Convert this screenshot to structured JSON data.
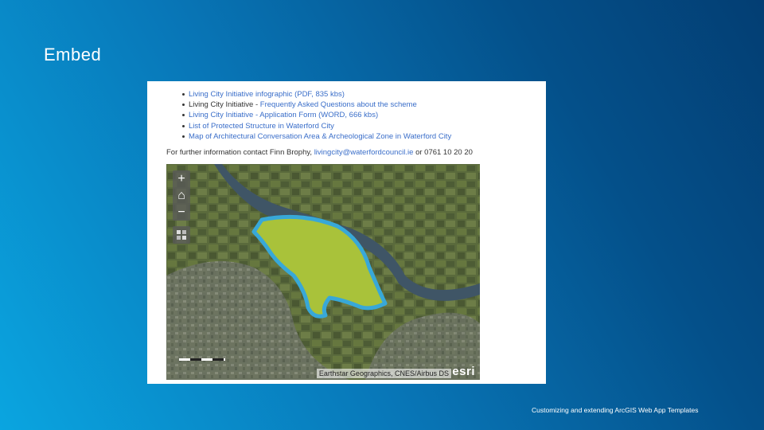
{
  "slide": {
    "title": "Embed",
    "footer": "Customizing and extending ArcGIS Web App Templates"
  },
  "embed": {
    "links": [
      {
        "parts": [
          {
            "text": "Living City Initiative infographic (PDF, 835 kbs)",
            "link": true
          }
        ]
      },
      {
        "parts": [
          {
            "text": "Living City Initiative - ",
            "link": false
          },
          {
            "text": "Frequently Asked Questions about the scheme",
            "link": true
          }
        ]
      },
      {
        "parts": [
          {
            "text": "Living City Initiative - Application Form (WORD, 666 kbs)",
            "link": true
          }
        ]
      },
      {
        "parts": [
          {
            "text": "List of Protected Structure in Waterford City",
            "link": true
          }
        ]
      },
      {
        "parts": [
          {
            "text": "Map of Architectural Conversation Area & Archeological Zone in Waterford City",
            "link": true
          }
        ]
      }
    ],
    "contact": {
      "prefix": "For further information contact Finn Brophy, ",
      "email": "livingcity@waterfordcouncil.ie",
      "suffix": " or 0761 10 20 20"
    },
    "map": {
      "zoom_in": "+",
      "home": "⌂",
      "zoom_out": "−",
      "basemap_toggle": "grid-icon",
      "attribution": "Earthstar Geographics, CNES/Airbus DS",
      "logo": "esri",
      "colors": {
        "river": "#3f5566",
        "land": "#55633a",
        "zone_fill": "#a9c23a",
        "zone_outline": "#38a8d8"
      }
    }
  }
}
